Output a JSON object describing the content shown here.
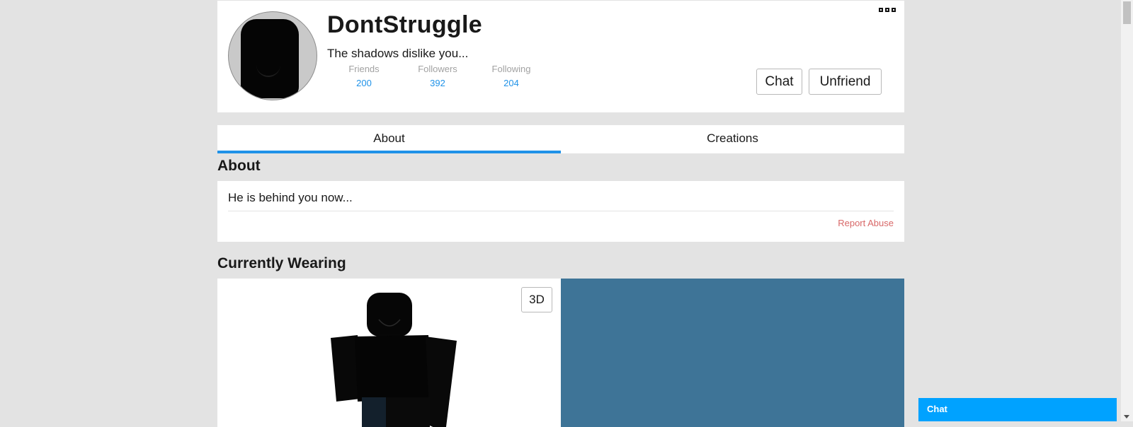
{
  "profile": {
    "username": "DontStruggle",
    "status": "The shadows dislike you...",
    "stats": [
      {
        "label": "Friends",
        "value": "200"
      },
      {
        "label": "Followers",
        "value": "392"
      },
      {
        "label": "Following",
        "value": "204"
      }
    ],
    "chat_label": "Chat",
    "unfriend_label": "Unfriend",
    "more_icon": "more-options-icon"
  },
  "tabs": [
    {
      "label": "About",
      "active": true
    },
    {
      "label": "Creations",
      "active": false
    }
  ],
  "about": {
    "title": "About",
    "description": "He is behind you now...",
    "report_label": "Report Abuse"
  },
  "wearing": {
    "title": "Currently Wearing",
    "view_toggle_label": "3D"
  },
  "chat_bar": {
    "label": "Chat"
  },
  "colors": {
    "accent": "#1f92e8",
    "report": "#d86868",
    "chat_bar": "#00a2ff",
    "wearing_panel": "#3e7497"
  }
}
